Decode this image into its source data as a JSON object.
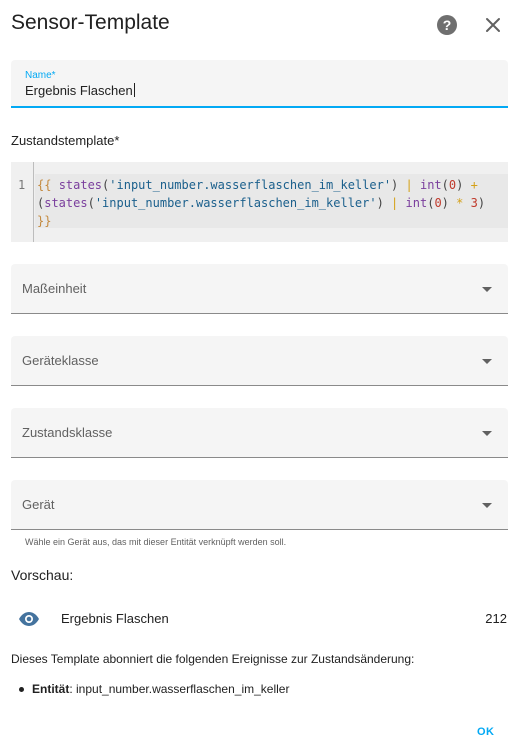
{
  "dialog": {
    "title": "Sensor-Template",
    "help_icon": "help-circle-icon",
    "close_icon": "close-icon"
  },
  "name_field": {
    "label": "Name*",
    "value": "Ergebnis Flaschen"
  },
  "state_template": {
    "label": "Zustandstemplate*",
    "line_number": "1",
    "code": "{{ states('input_number.wasserflaschen_im_keller') | int(0) + (states('input_number.wasserflaschen_im_keller') | int(0) * 3) }}"
  },
  "selects": [
    {
      "label": "Maßeinheit"
    },
    {
      "label": "Geräteklasse"
    },
    {
      "label": "Zustandsklasse"
    },
    {
      "label": "Gerät"
    }
  ],
  "device_helper": "Wähle ein Gerät aus, das mit dieser Entität verknüpft werden soll.",
  "preview": {
    "label": "Vorschau:",
    "icon": "eye-icon",
    "name": "Ergebnis Flaschen",
    "value": "212"
  },
  "subscription": {
    "description": "Dieses Template abonniert die folgenden Ereignisse zur Zustandsänderung:",
    "entity_label": "Entität",
    "entity_value": ": input_number.wasserflaschen_im_keller"
  },
  "actions": {
    "ok_label": "OK"
  },
  "colors": {
    "accent": "#03a9f4",
    "field_bg": "#f5f5f5"
  }
}
